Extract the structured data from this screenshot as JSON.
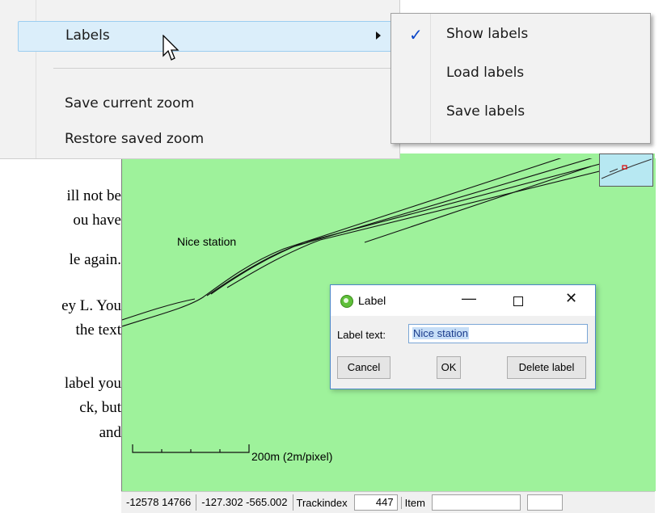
{
  "document": {
    "lines": [
      "ill not be",
      "ou have",
      "le again.",
      "ey L. You",
      "the text",
      "label you",
      "ck, but",
      "and"
    ]
  },
  "context_menu": {
    "items": [
      {
        "label": "Labels",
        "has_submenu": true,
        "highlighted": true
      },
      {
        "label": "Save current zoom"
      },
      {
        "label": "Restore saved zoom"
      }
    ]
  },
  "submenu": {
    "items": [
      {
        "label": "Show labels",
        "checked": true
      },
      {
        "label": "Load labels"
      },
      {
        "label": "Save labels"
      }
    ]
  },
  "map": {
    "label": "Nice station",
    "scale_text": "200m (2m/pixel)",
    "background_color": "#9ef29b"
  },
  "dialog": {
    "title": "Label",
    "minimize_symbol": "—",
    "close_symbol": "✕",
    "field_label": "Label text:",
    "field_value": "Nice station",
    "buttons": {
      "cancel": "Cancel",
      "ok": "OK",
      "delete": "Delete label"
    }
  },
  "statusbar": {
    "coords_xy": "-12578  14766",
    "coords_local": "-127.302   -565.002",
    "trackindex_label": "Trackindex",
    "trackindex_value": "447",
    "item_label": "Item",
    "item_value": ""
  },
  "icons": {
    "check": "✓"
  }
}
